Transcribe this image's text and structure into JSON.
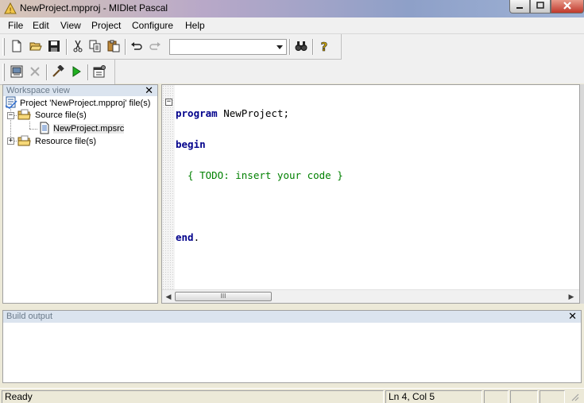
{
  "window": {
    "title": "NewProject.mpproj - MIDlet Pascal",
    "controls": [
      "minimize-icon",
      "maximize-icon",
      "close-icon"
    ]
  },
  "menu": {
    "items": [
      "File",
      "Edit",
      "View",
      "Project",
      "Configure",
      "Help"
    ]
  },
  "toolbar1": {
    "buttons": [
      "new-file-icon",
      "open-folder-icon",
      "save-icon",
      "cut-icon",
      "copy-icon",
      "paste-icon",
      "undo-icon",
      "redo-icon",
      "find-icon",
      "help-icon"
    ],
    "combo_value": ""
  },
  "toolbar2": {
    "buttons": [
      "emulator-icon",
      "stop-icon",
      "build-hammer-icon",
      "run-icon",
      "properties-icon"
    ]
  },
  "workspace": {
    "header": "Workspace view",
    "tree": {
      "project": "Project 'NewProject.mpproj' file(s)",
      "source_folder": "Source file(s)",
      "source_file": "NewProject.mpsrc",
      "resource_folder": "Resource file(s)"
    }
  },
  "editor": {
    "line1_kw": "program",
    "line1_rest": " NewProject;",
    "line2_kw": "begin",
    "line3_comment": "  { TODO: insert your code }",
    "line5_kw": "end",
    "line5_rest": ".",
    "scroll_thumb_label": "III"
  },
  "build_output": {
    "header": "Build output"
  },
  "status": {
    "message": "Ready",
    "position": "Ln 4, Col 5"
  },
  "colors": {
    "keyword": "#00008b",
    "comment": "#008000",
    "panel_header_bg": "#dbe4ef"
  }
}
